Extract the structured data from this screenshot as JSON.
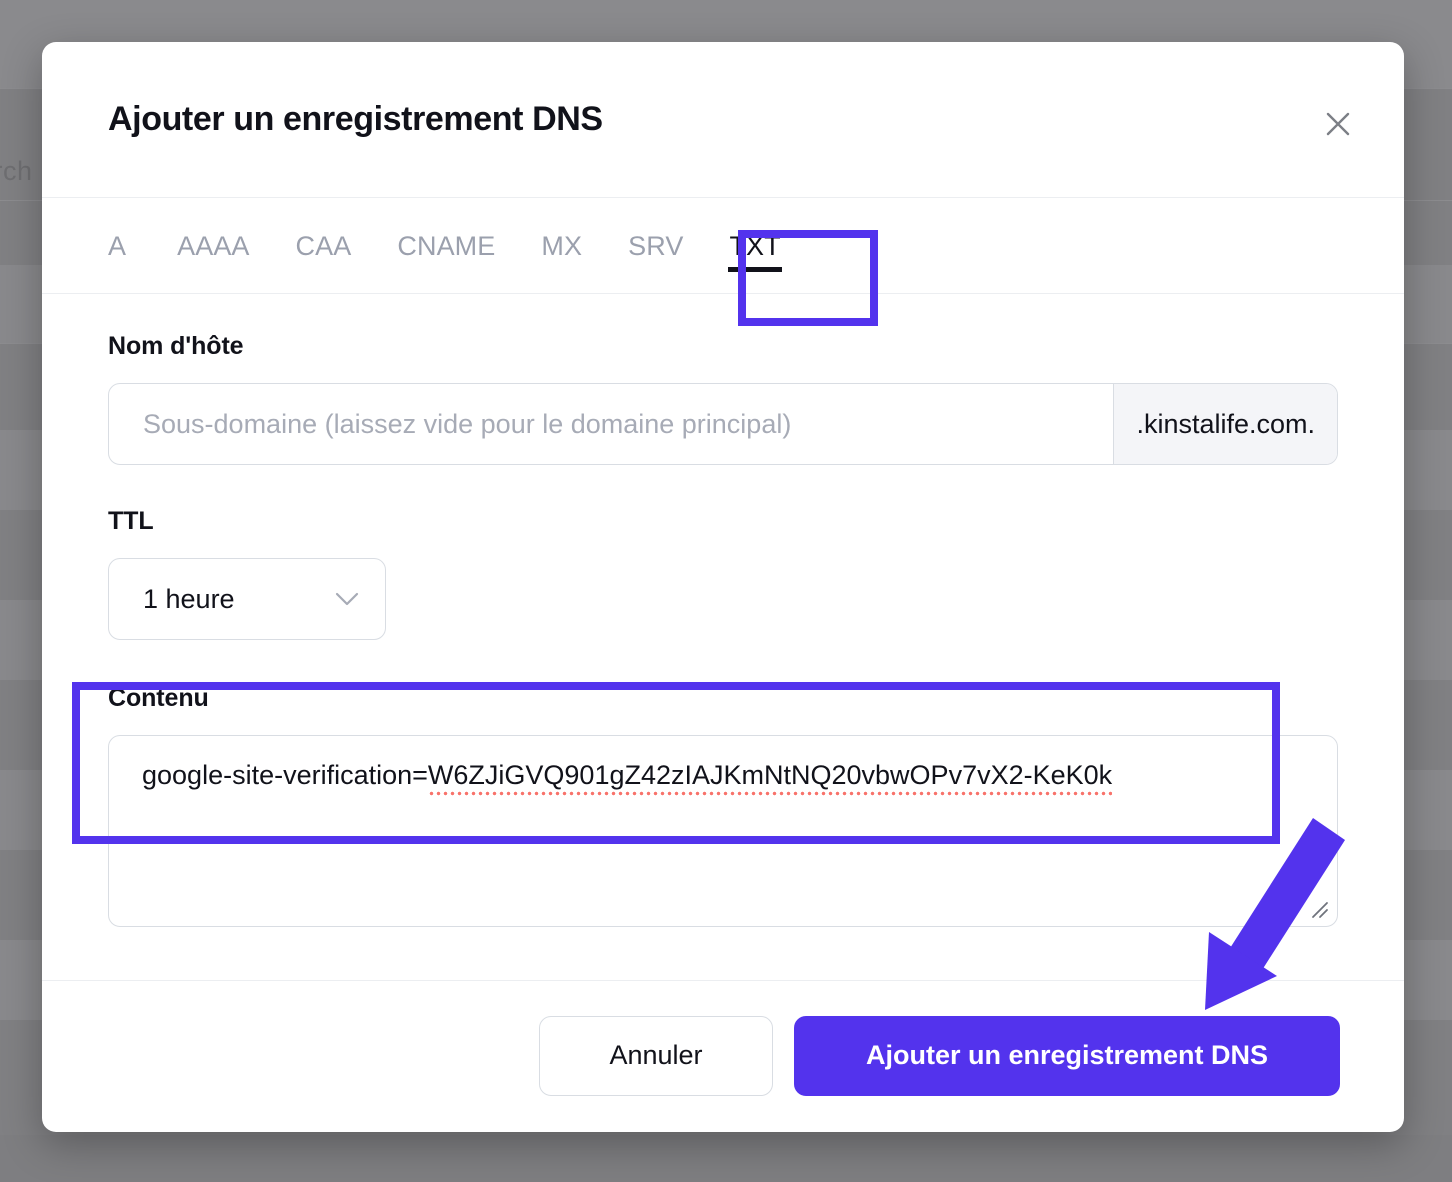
{
  "backdrop": {
    "partial_text": "arch"
  },
  "modal": {
    "title": "Ajouter un enregistrement DNS",
    "close_icon": "close-icon",
    "tabs": [
      {
        "label": "A",
        "active": false
      },
      {
        "label": "AAAA",
        "active": false
      },
      {
        "label": "CAA",
        "active": false
      },
      {
        "label": "CNAME",
        "active": false
      },
      {
        "label": "MX",
        "active": false
      },
      {
        "label": "SRV",
        "active": false
      },
      {
        "label": "TXT",
        "active": true
      }
    ],
    "fields": {
      "hostname": {
        "label": "Nom d'hôte",
        "value": "",
        "placeholder": "Sous-domaine (laissez vide pour le domaine principal)",
        "suffix": ".kinstalife.com."
      },
      "ttl": {
        "label": "TTL",
        "value": "1 heure",
        "caret_icon": "chevron-down-icon"
      },
      "content": {
        "label": "Contenu",
        "value": "google-site-verification=W6ZJiGVQ901gZ42zIAJKmNtNQ20vbwOPv7vX2-KeK0k",
        "spellcheck_prefix": "google-site-verification=",
        "spellcheck_token": "W6ZJiGVQ901gZ42zIAJKmNtNQ20vbwOPv7vX2-KeK0k",
        "resize_handle_icon": "resize-handle-icon"
      }
    },
    "footer": {
      "cancel_label": "Annuler",
      "submit_label": "Ajouter un enregistrement DNS"
    }
  },
  "annotations": {
    "accent_color": "#5333ED",
    "boxes": [
      {
        "name": "txt-tab-highlight"
      },
      {
        "name": "content-field-highlight"
      }
    ],
    "arrow": {
      "name": "submit-arrow",
      "points_to": "Ajouter un enregistrement DNS"
    }
  },
  "colors": {
    "accent": "#5333ED",
    "text": "#11121A",
    "muted": "#9BA0AD",
    "border": "#D9DDE3",
    "suffix_bg": "#F4F5F8",
    "spellcheck": "#F8736B",
    "backdrop": "#808083"
  }
}
